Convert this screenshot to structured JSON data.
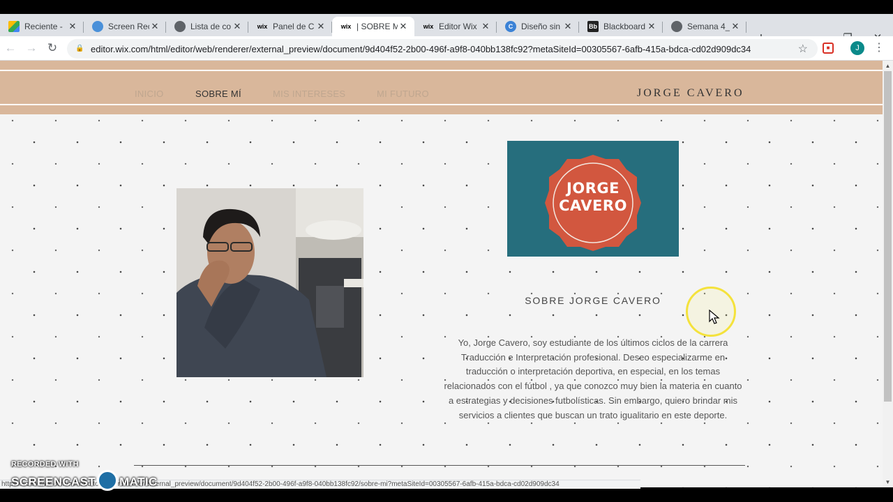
{
  "browser": {
    "tabs": [
      {
        "label": "Reciente - ",
        "icon": "google-drive-icon",
        "active": false
      },
      {
        "label": "Screen Rec",
        "icon": "screencast-icon",
        "active": false
      },
      {
        "label": "Lista de co",
        "icon": "globe-icon",
        "active": false
      },
      {
        "label": "Panel de C",
        "icon": "wix-icon",
        "active": false
      },
      {
        "label": "| SOBRE MÍ",
        "icon": "wix-icon",
        "active": true
      },
      {
        "label": "Editor Wix",
        "icon": "wix-icon",
        "active": false
      },
      {
        "label": "Diseño sin",
        "icon": "canva-icon",
        "active": false
      },
      {
        "label": "Blackboard",
        "icon": "blackboard-icon",
        "active": false
      },
      {
        "label": "Semana 4_",
        "icon": "globe-icon",
        "active": false
      }
    ],
    "new_tab": "+",
    "window_controls": {
      "minimize": "—",
      "restore": "❐",
      "close": "✕"
    },
    "url": "editor.wix.com/html/editor/web/renderer/external_preview/document/9d404f52-2b00-496f-a9f8-040bb138fc92?metaSiteId=00305567-6afb-415a-bdca-cd02d909dc34",
    "profile_initial": "J",
    "status_url": "https://editor.wix.com/html/editor/web/renderer/external_preview/document/9d404f52-2b00-496f-a9f8-040bb138fc92/sobre-mi?metaSiteId=00305567-6afb-415a-bdca-cd02d909dc34"
  },
  "site": {
    "nav": [
      {
        "label": "INICIO",
        "current": false
      },
      {
        "label": "SOBRE MÍ",
        "current": true
      },
      {
        "label": "MIS INTERESES",
        "current": false
      },
      {
        "label": "MI FUTURO",
        "current": false
      }
    ],
    "brand": "JORGE CAVERO",
    "logo_text_line1": "JORGE",
    "logo_text_line2": "CAVERO",
    "about_title": "SOBRE JORGE CAVERO",
    "about_text": "Yo, Jorge Cavero, soy estudiante de los últimos ciclos de la carrera Traducción e Interpretación profesional. Deseo especializarme en traducción o interpretación deportiva, en especial, en los temas relacionados con el fútbol , ya que conozco muy bien la materia en cuanto a estrategias y decisiones futbolísticas. Sin embargo, quiero brindar mis servicios a clientes que buscan un trato igualitario en este deporte."
  },
  "colors": {
    "header_bg": "#d9b79b",
    "logo_bg": "#266e7d",
    "seal": "#d2573f",
    "page_bg": "#f4f4f4"
  },
  "watermark": {
    "line1": "RECORDED WITH",
    "line2a": "SCREENCAST",
    "line2b": "MATIC"
  }
}
